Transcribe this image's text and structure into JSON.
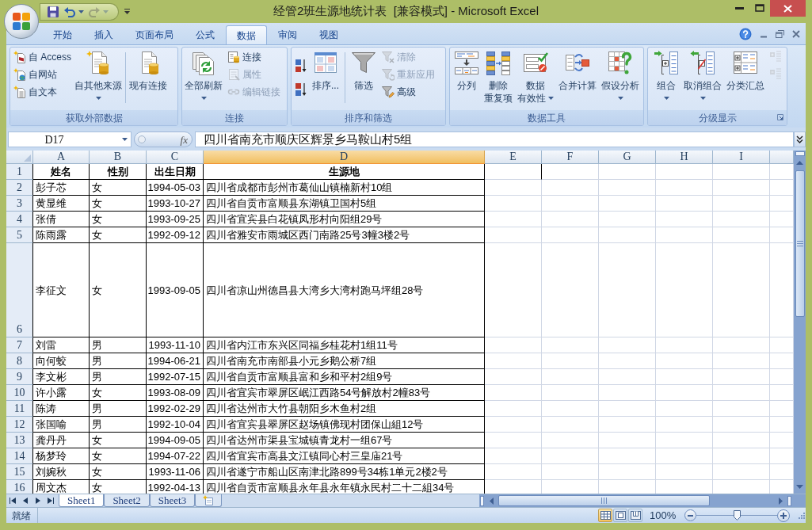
{
  "window": {
    "title": "经管2班生源地统计表  [兼容模式] - Microsoft Excel"
  },
  "quick_access": [
    {
      "disabled": false
    },
    {
      "disabled": false
    },
    {
      "disabled": true
    }
  ],
  "tabs": [
    {
      "label": "开始",
      "selected": false
    },
    {
      "label": "插入",
      "selected": false
    },
    {
      "label": "页面布局",
      "selected": false
    },
    {
      "label": "公式",
      "selected": false
    },
    {
      "label": "数据",
      "selected": true
    },
    {
      "label": "审阅",
      "selected": false
    },
    {
      "label": "视图",
      "selected": false
    }
  ],
  "ribbon": [
    {
      "title": "获取外部数据",
      "dialog_launcher": false,
      "columns": [
        {
          "kind": "small",
          "buttons": [
            {
              "label": "自 Access",
              "disabled": false
            },
            {
              "label": "自网站",
              "disabled": false
            },
            {
              "label": "自文本",
              "disabled": false
            }
          ]
        },
        {
          "kind": "large",
          "lines": [
            "自其他来源"
          ],
          "dropdown": true
        },
        {
          "kind": "separator"
        },
        {
          "kind": "large",
          "lines": [
            "现有连接"
          ],
          "dropdown": false
        }
      ]
    },
    {
      "title": "连接",
      "dialog_launcher": false,
      "columns": [
        {
          "kind": "large",
          "lines": [
            "全部刷新"
          ],
          "dropdown": true
        },
        {
          "kind": "small",
          "buttons": [
            {
              "label": "连接",
              "disabled": false
            },
            {
              "label": "属性",
              "disabled": true
            },
            {
              "label": "编辑链接",
              "disabled": true
            }
          ]
        }
      ]
    },
    {
      "title": "排序和筛选",
      "dialog_launcher": false,
      "columns": [
        {
          "kind": "icons",
          "buttons": [
            {
              "disabled": false
            },
            {
              "disabled": false
            }
          ]
        },
        {
          "kind": "large",
          "lines": [
            "排序..."
          ],
          "dropdown": false
        },
        {
          "kind": "separator"
        },
        {
          "kind": "large",
          "lines": [
            "筛选"
          ],
          "dropdown": false
        },
        {
          "kind": "small",
          "buttons": [
            {
              "label": "清除",
              "disabled": true
            },
            {
              "label": "重新应用",
              "disabled": true
            },
            {
              "label": "高级",
              "disabled": false
            }
          ]
        }
      ]
    },
    {
      "title": "数据工具",
      "dialog_launcher": false,
      "columns": [
        {
          "kind": "large",
          "lines": [
            "分列"
          ],
          "dropdown": false
        },
        {
          "kind": "large",
          "lines": [
            "删除",
            "重复项"
          ],
          "dropdown": false
        },
        {
          "kind": "large",
          "lines": [
            "数据",
            "有效性"
          ],
          "dropdown": true
        },
        {
          "kind": "large",
          "lines": [
            "合并计算"
          ],
          "dropdown": false
        },
        {
          "kind": "large",
          "lines": [
            "假设分析"
          ],
          "dropdown": true
        }
      ]
    },
    {
      "title": "分级显示",
      "dialog_launcher": true,
      "columns": [
        {
          "kind": "large",
          "lines": [
            "组合"
          ],
          "dropdown": true
        },
        {
          "kind": "large",
          "lines": [
            "取消组合"
          ],
          "dropdown": true
        },
        {
          "kind": "large",
          "lines": [
            "分类汇总"
          ],
          "dropdown": false
        },
        {
          "kind": "icons",
          "buttons": [
            {
              "disabled": true
            },
            {
              "disabled": true
            }
          ]
        }
      ]
    }
  ],
  "formula_bar": {
    "cell_reference": "D17",
    "function_label": "fx",
    "formula": "四川省南充市顺庆区辉景乡马鞍山村5组"
  },
  "sheet": {
    "columns": [
      {
        "label": "A",
        "selected": false
      },
      {
        "label": "B",
        "selected": false
      },
      {
        "label": "C",
        "selected": false
      },
      {
        "label": "D",
        "selected": true
      },
      {
        "label": "E",
        "selected": false
      },
      {
        "label": "F",
        "selected": false
      },
      {
        "label": "G",
        "selected": false
      },
      {
        "label": "H",
        "selected": false
      },
      {
        "label": "I",
        "selected": false
      }
    ],
    "rows": [
      {
        "number": "1",
        "kind": "header",
        "cells": [
          "姓名",
          "性别",
          "出生日期",
          "生源地"
        ]
      },
      {
        "number": "2",
        "kind": "normal",
        "cells": [
          "彭子芯",
          "女",
          "1994-05-03",
          "四川省成都市彭州市葛仙山镇楠新村10组"
        ]
      },
      {
        "number": "3",
        "kind": "normal",
        "cells": [
          "黄显维",
          "女",
          "1993-10-27",
          "四川省自贡市富顺县东湖镇卫国村5组"
        ]
      },
      {
        "number": "4",
        "kind": "normal",
        "cells": [
          "张倩",
          "女",
          "1993-09-25",
          "四川省宜宾县白花镇凤形村向阳组29号"
        ]
      },
      {
        "number": "5",
        "kind": "normal",
        "cells": [
          "陈雨露",
          "女",
          "1992-09-12",
          "四川省雅安市雨城区西门南路25号3幢3楼2号"
        ]
      },
      {
        "number": "6",
        "kind": "tall",
        "cells": [
          "李征文",
          "女",
          "1993-09-05",
          "四川省凉山州德昌县大湾乡大湾村跑马坪组28号"
        ]
      },
      {
        "number": "7",
        "kind": "normal",
        "cells": [
          "刘雷",
          "男",
          "1993-11-10",
          "四川省内江市东兴区同福乡桂花村1组11号"
        ]
      },
      {
        "number": "8",
        "kind": "normal",
        "cells": [
          "向何蛟",
          "男",
          "1994-06-21",
          "四川省南充市南部县小元乡鹅公桥7组"
        ]
      },
      {
        "number": "9",
        "kind": "normal",
        "cells": [
          "李文彬",
          "男",
          "1992-07-15",
          "四川省自贡市富顺县富和乡和平村2组9号"
        ]
      },
      {
        "number": "10",
        "kind": "normal",
        "cells": [
          "许小露",
          "女",
          "1993-08-09",
          "四川省宜宾市翠屏区岷江西路54号解放村2幢83号"
        ]
      },
      {
        "number": "11",
        "kind": "normal",
        "cells": [
          "陈涛",
          "男",
          "1992-02-29",
          "四川省达州市大竹县朝阳乡木鱼村2组"
        ]
      },
      {
        "number": "12",
        "kind": "normal",
        "cells": [
          "张国喻",
          "男",
          "1992-10-04",
          "四川省宜宾县翠屏区赵场镇佛现村团保山組12号"
        ]
      },
      {
        "number": "13",
        "kind": "normal",
        "cells": [
          "龚丹丹",
          "女",
          "1994-09-05",
          "四川省达州市渠县宝城镇青龙村一组67号"
        ]
      },
      {
        "number": "14",
        "kind": "normal",
        "cells": [
          "杨梦玲",
          "女",
          "1994-07-22",
          "四川省宜宾市高县文江镇同心村三皇庙21号"
        ]
      },
      {
        "number": "15",
        "kind": "normal",
        "cells": [
          "刘婉秋",
          "女",
          "1993-11-06",
          "四川省遂宁市船山区南津北路899号34栋1单元2楼2号"
        ]
      },
      {
        "number": "16",
        "kind": "normal",
        "cells": [
          "周文杰",
          "女",
          "1992-04-13",
          "四川省自贡市富顺县永年县永年镇永民村二十二組34号"
        ]
      }
    ]
  },
  "sheet_tabs": [
    {
      "label": "Sheet1",
      "selected": true
    },
    {
      "label": "Sheet2",
      "selected": false
    },
    {
      "label": "Sheet3",
      "selected": false
    }
  ],
  "status_bar": {
    "text": "就绪",
    "views": [
      {
        "selected": true
      },
      {
        "selected": false
      },
      {
        "selected": false
      }
    ],
    "zoom": {
      "reading": "100%",
      "level": 0.5
    }
  }
}
